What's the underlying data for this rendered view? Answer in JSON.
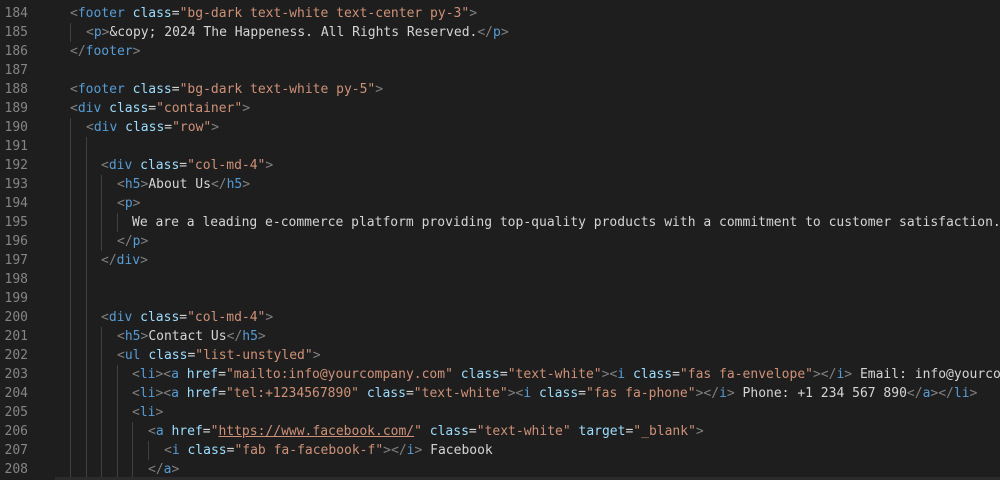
{
  "theme": {
    "background": "#1e1e1e",
    "line_number": "#858585",
    "tag": "#569cd6",
    "bracket": "#808080",
    "attribute": "#9cdcfe",
    "string": "#ce9178",
    "text": "#d4d4d4"
  },
  "lines": [
    {
      "n": "184",
      "indent": 0,
      "tokens": [
        [
          "b",
          "<"
        ],
        [
          "tag",
          "footer"
        ],
        [
          "text",
          " "
        ],
        [
          "attr",
          "class"
        ],
        [
          "text",
          "="
        ],
        [
          "str",
          "\"bg-dark text-white text-center py-3\""
        ],
        [
          "b",
          ">"
        ]
      ]
    },
    {
      "n": "185",
      "indent": 1,
      "tokens": [
        [
          "b",
          "<"
        ],
        [
          "tag",
          "p"
        ],
        [
          "b",
          ">"
        ],
        [
          "ent",
          "&copy;"
        ],
        [
          "text",
          " 2024 The Happeness. All Rights Reserved."
        ],
        [
          "b",
          "</"
        ],
        [
          "tag",
          "p"
        ],
        [
          "b",
          ">"
        ]
      ]
    },
    {
      "n": "186",
      "indent": 0,
      "tokens": [
        [
          "b",
          "</"
        ],
        [
          "tag",
          "footer"
        ],
        [
          "b",
          ">"
        ]
      ]
    },
    {
      "n": "187",
      "indent": 0,
      "tokens": []
    },
    {
      "n": "188",
      "indent": 0,
      "tokens": [
        [
          "b",
          "<"
        ],
        [
          "tag",
          "footer"
        ],
        [
          "text",
          " "
        ],
        [
          "attr",
          "class"
        ],
        [
          "text",
          "="
        ],
        [
          "str",
          "\"bg-dark text-white py-5\""
        ],
        [
          "b",
          ">"
        ]
      ]
    },
    {
      "n": "189",
      "indent": 0,
      "tokens": [
        [
          "b",
          "<"
        ],
        [
          "tag",
          "div"
        ],
        [
          "text",
          " "
        ],
        [
          "attr",
          "class"
        ],
        [
          "text",
          "="
        ],
        [
          "str",
          "\"container\""
        ],
        [
          "b",
          ">"
        ]
      ]
    },
    {
      "n": "190",
      "indent": 1,
      "tokens": [
        [
          "b",
          "<"
        ],
        [
          "tag",
          "div"
        ],
        [
          "text",
          " "
        ],
        [
          "attr",
          "class"
        ],
        [
          "text",
          "="
        ],
        [
          "str",
          "\"row\""
        ],
        [
          "b",
          ">"
        ]
      ]
    },
    {
      "n": "191",
      "indent": 2,
      "tokens": []
    },
    {
      "n": "192",
      "indent": 2,
      "tokens": [
        [
          "b",
          "<"
        ],
        [
          "tag",
          "div"
        ],
        [
          "text",
          " "
        ],
        [
          "attr",
          "class"
        ],
        [
          "text",
          "="
        ],
        [
          "str",
          "\"col-md-4\""
        ],
        [
          "b",
          ">"
        ]
      ]
    },
    {
      "n": "193",
      "indent": 3,
      "tokens": [
        [
          "b",
          "<"
        ],
        [
          "tag",
          "h5"
        ],
        [
          "b",
          ">"
        ],
        [
          "text",
          "About Us"
        ],
        [
          "b",
          "</"
        ],
        [
          "tag",
          "h5"
        ],
        [
          "b",
          ">"
        ]
      ]
    },
    {
      "n": "194",
      "indent": 3,
      "tokens": [
        [
          "b",
          "<"
        ],
        [
          "tag",
          "p"
        ],
        [
          "b",
          ">"
        ]
      ]
    },
    {
      "n": "195",
      "indent": 4,
      "tokens": [
        [
          "text",
          "We are a leading e-commerce platform providing top-quality products with a commitment to customer satisfaction. O"
        ]
      ]
    },
    {
      "n": "196",
      "indent": 3,
      "tokens": [
        [
          "b",
          "</"
        ],
        [
          "tag",
          "p"
        ],
        [
          "b",
          ">"
        ]
      ]
    },
    {
      "n": "197",
      "indent": 2,
      "tokens": [
        [
          "b",
          "</"
        ],
        [
          "tag",
          "div"
        ],
        [
          "b",
          ">"
        ]
      ]
    },
    {
      "n": "198",
      "indent": 2,
      "tokens": []
    },
    {
      "n": "199",
      "indent": 2,
      "tokens": []
    },
    {
      "n": "200",
      "indent": 2,
      "tokens": [
        [
          "b",
          "<"
        ],
        [
          "tag",
          "div"
        ],
        [
          "text",
          " "
        ],
        [
          "attr",
          "class"
        ],
        [
          "text",
          "="
        ],
        [
          "str",
          "\"col-md-4\""
        ],
        [
          "b",
          ">"
        ]
      ]
    },
    {
      "n": "201",
      "indent": 3,
      "tokens": [
        [
          "b",
          "<"
        ],
        [
          "tag",
          "h5"
        ],
        [
          "b",
          ">"
        ],
        [
          "text",
          "Contact Us"
        ],
        [
          "b",
          "</"
        ],
        [
          "tag",
          "h5"
        ],
        [
          "b",
          ">"
        ]
      ]
    },
    {
      "n": "202",
      "indent": 3,
      "tokens": [
        [
          "b",
          "<"
        ],
        [
          "tag",
          "ul"
        ],
        [
          "text",
          " "
        ],
        [
          "attr",
          "class"
        ],
        [
          "text",
          "="
        ],
        [
          "str",
          "\"list-unstyled\""
        ],
        [
          "b",
          ">"
        ]
      ]
    },
    {
      "n": "203",
      "indent": 4,
      "tokens": [
        [
          "b",
          "<"
        ],
        [
          "tag",
          "li"
        ],
        [
          "b",
          "><"
        ],
        [
          "tag",
          "a"
        ],
        [
          "text",
          " "
        ],
        [
          "attr",
          "href"
        ],
        [
          "text",
          "="
        ],
        [
          "str",
          "\"mailto:info@yourcompany.com\""
        ],
        [
          "text",
          " "
        ],
        [
          "attr",
          "class"
        ],
        [
          "text",
          "="
        ],
        [
          "str",
          "\"text-white\""
        ],
        [
          "b",
          "><"
        ],
        [
          "tag",
          "i"
        ],
        [
          "text",
          " "
        ],
        [
          "attr",
          "class"
        ],
        [
          "text",
          "="
        ],
        [
          "str",
          "\"fas fa-envelope\""
        ],
        [
          "b",
          "></"
        ],
        [
          "tag",
          "i"
        ],
        [
          "b",
          ">"
        ],
        [
          "text",
          " Email: info@yourcomp"
        ]
      ]
    },
    {
      "n": "204",
      "indent": 4,
      "tokens": [
        [
          "b",
          "<"
        ],
        [
          "tag",
          "li"
        ],
        [
          "b",
          "><"
        ],
        [
          "tag",
          "a"
        ],
        [
          "text",
          " "
        ],
        [
          "attr",
          "href"
        ],
        [
          "text",
          "="
        ],
        [
          "str",
          "\"tel:+1234567890\""
        ],
        [
          "text",
          " "
        ],
        [
          "attr",
          "class"
        ],
        [
          "text",
          "="
        ],
        [
          "str",
          "\"text-white\""
        ],
        [
          "b",
          "><"
        ],
        [
          "tag",
          "i"
        ],
        [
          "text",
          " "
        ],
        [
          "attr",
          "class"
        ],
        [
          "text",
          "="
        ],
        [
          "str",
          "\"fas fa-phone\""
        ],
        [
          "b",
          "></"
        ],
        [
          "tag",
          "i"
        ],
        [
          "b",
          ">"
        ],
        [
          "text",
          " Phone: +1 234 567 890"
        ],
        [
          "b",
          "</"
        ],
        [
          "tag",
          "a"
        ],
        [
          "b",
          "></"
        ],
        [
          "tag",
          "li"
        ],
        [
          "b",
          ">"
        ]
      ]
    },
    {
      "n": "205",
      "indent": 4,
      "tokens": [
        [
          "b",
          "<"
        ],
        [
          "tag",
          "li"
        ],
        [
          "b",
          ">"
        ]
      ]
    },
    {
      "n": "206",
      "indent": 5,
      "tokens": [
        [
          "b",
          "<"
        ],
        [
          "tag",
          "a"
        ],
        [
          "text",
          " "
        ],
        [
          "attr",
          "href"
        ],
        [
          "text",
          "="
        ],
        [
          "str",
          "\""
        ],
        [
          "url",
          "https://www.facebook.com/"
        ],
        [
          "str",
          "\""
        ],
        [
          "text",
          " "
        ],
        [
          "attr",
          "class"
        ],
        [
          "text",
          "="
        ],
        [
          "str",
          "\"text-white\""
        ],
        [
          "text",
          " "
        ],
        [
          "attr",
          "target"
        ],
        [
          "text",
          "="
        ],
        [
          "str",
          "\"_blank\""
        ],
        [
          "b",
          ">"
        ]
      ]
    },
    {
      "n": "207",
      "indent": 6,
      "tokens": [
        [
          "b",
          "<"
        ],
        [
          "tag",
          "i"
        ],
        [
          "text",
          " "
        ],
        [
          "attr",
          "class"
        ],
        [
          "text",
          "="
        ],
        [
          "str",
          "\"fab fa-facebook-f\""
        ],
        [
          "b",
          "></"
        ],
        [
          "tag",
          "i"
        ],
        [
          "b",
          ">"
        ],
        [
          "text",
          " Facebook"
        ]
      ]
    },
    {
      "n": "208",
      "indent": 5,
      "tokens": [
        [
          "b",
          "</"
        ],
        [
          "tag",
          "a"
        ],
        [
          "b",
          ">"
        ]
      ]
    }
  ]
}
